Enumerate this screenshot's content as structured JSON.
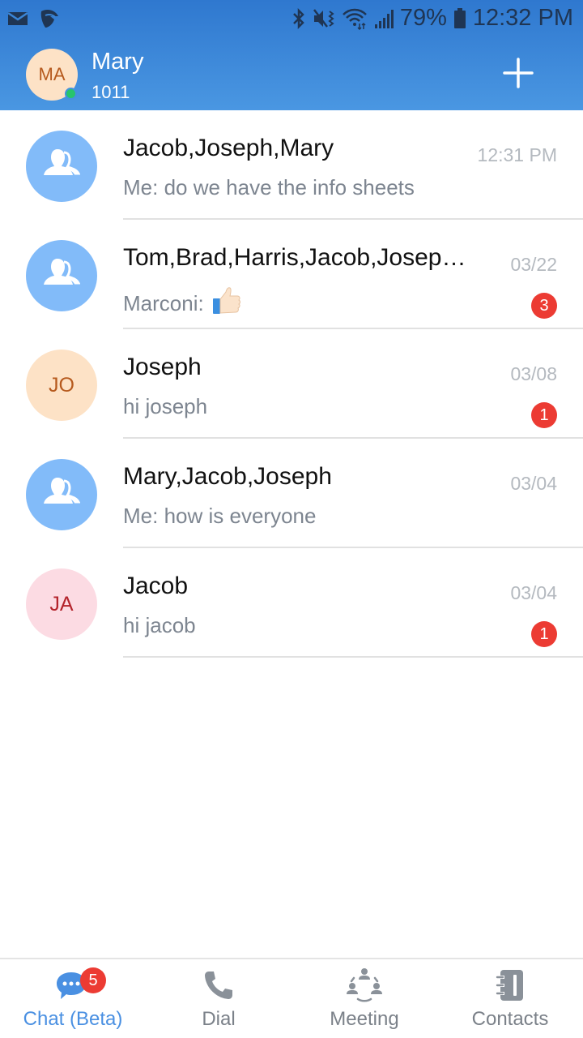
{
  "status_bar": {
    "battery_percent": "79%",
    "time": "12:32 PM",
    "left_icons": [
      "mail-icon",
      "grandstream-app-icon"
    ],
    "right_icons": [
      "bluetooth-icon",
      "vibrate-mute-icon",
      "wifi-icon",
      "cell-signal-icon",
      "battery-icon"
    ]
  },
  "header": {
    "user_initials": "MA",
    "user_name": "Mary",
    "user_extension": "1011",
    "presence": "online",
    "add_button_icon": "plus-icon"
  },
  "chats": [
    {
      "title": "Jacob,Joseph,Mary",
      "preview": "Me: do we have the info sheets",
      "time": "12:31 PM",
      "avatar_type": "group",
      "unread": null
    },
    {
      "title": "Tom,Brad,Harris,Jacob,Joseph,Mary",
      "preview": "Marconi:",
      "preview_emoji": "👍🏻",
      "time": "03/22",
      "avatar_type": "group",
      "unread": "3"
    },
    {
      "title": "Joseph",
      "preview": "hi joseph",
      "time": "03/08",
      "avatar_type": "initials",
      "initials": "JO",
      "unread": "1"
    },
    {
      "title": "Mary,Jacob,Joseph",
      "preview": "Me: how is everyone",
      "time": "03/04",
      "avatar_type": "group",
      "unread": null
    },
    {
      "title": "Jacob",
      "preview": "hi jacob",
      "time": "03/04",
      "avatar_type": "initials",
      "initials": "JA",
      "unread": "1"
    }
  ],
  "bottom_nav": {
    "items": [
      {
        "label": "Chat (Beta)",
        "icon": "chat-bubble-icon",
        "active": true,
        "badge": "5"
      },
      {
        "label": "Dial",
        "icon": "phone-icon",
        "active": false
      },
      {
        "label": "Meeting",
        "icon": "meeting-icon",
        "active": false
      },
      {
        "label": "Contacts",
        "icon": "contacts-book-icon",
        "active": false
      }
    ]
  },
  "colors": {
    "header_top": "#2f78cf",
    "header_bottom": "#4a97e2",
    "accent": "#4a90e2",
    "badge": "#ec3b33",
    "presence_online": "#27c46d",
    "group_avatar": "#82bbf9"
  }
}
